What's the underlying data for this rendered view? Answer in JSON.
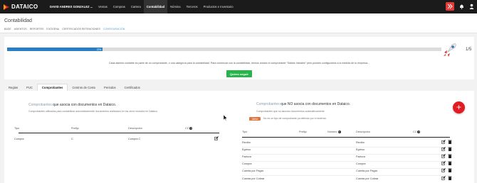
{
  "brand": {
    "name": "DATAICO",
    "accent": "#e31b23"
  },
  "topbar": {
    "user": "DAVID ANDRES GONZALEZ ...",
    "nav": [
      "Ventas",
      "Compras",
      "Cartera",
      "Contabilidad",
      "Nómina",
      "Terceros",
      "Productos e Inventario"
    ],
    "active_nav": "Contabilidad",
    "icons": [
      "exit-icon",
      "bell-icon",
      "user-icon"
    ]
  },
  "page": {
    "title": "Contabilidad",
    "breadcrumb": [
      "BASE",
      "ASIENTOS",
      "REPORTES",
      "EXÓGENA",
      "CERTIFICADOS RETENCIONES",
      "CONFIGURACIÓN"
    ]
  },
  "progress": {
    "percent_label": "22%",
    "fraction": 0.22,
    "step": "1/5",
    "info": "Cada asiento contable es parte de un comprobante, o una categoría para la contabilidad. Para comenzar con la contabilidad, hemos creado el comprobante \"Saldos Iniciales\" pero puedes configurarlos a la medida de tu empresa...",
    "button": "Quiero seguir"
  },
  "tabs": [
    "Reglas",
    "PUC",
    "Comprobantes",
    "Centros de Costo",
    "Periodos",
    "Certificados"
  ],
  "active_tab": "Comprobantes",
  "left": {
    "title_muted": "Comprobantes",
    "title_rest": " que asocia con documentos en Dataico.",
    "subtitle": "Comprobantes utilizados para contabilizar automáticamente documentos realizados en los otros módulos en Dataico.",
    "columns": [
      "Tipo",
      "Prefijo",
      "Descripción",
      "CC"
    ],
    "rows": [
      {
        "tipo": "Compra",
        "prefijo": "C",
        "descripcion": "Compra C"
      }
    ]
  },
  "right": {
    "title_muted": "Comprobantes",
    "title_rest": " que NO asocia con documentos en Dataico.",
    "subtitle": "Comprobantes que no asocian documentos automáticamente.",
    "badge": "Alerta",
    "badge_text": "No es un tipo de comprobante ya definido por el sistema.",
    "columns": [
      "Tipo",
      "Prefijo",
      "Número",
      "Descripción",
      "CC"
    ],
    "rows": [
      {
        "tipo": "Recibo",
        "descripcion": "Recibo"
      },
      {
        "tipo": "Egreso",
        "descripcion": "Egreso"
      },
      {
        "tipo": "Factura",
        "descripcion": "Factura"
      },
      {
        "tipo": "Compra",
        "descripcion": "Compra"
      },
      {
        "tipo": "Cuenta por Pagar",
        "descripcion": "Cuenta por Pagar"
      },
      {
        "tipo": "Cuenta por Cobrar",
        "descripcion": "Cuenta por Cobrar"
      }
    ]
  }
}
